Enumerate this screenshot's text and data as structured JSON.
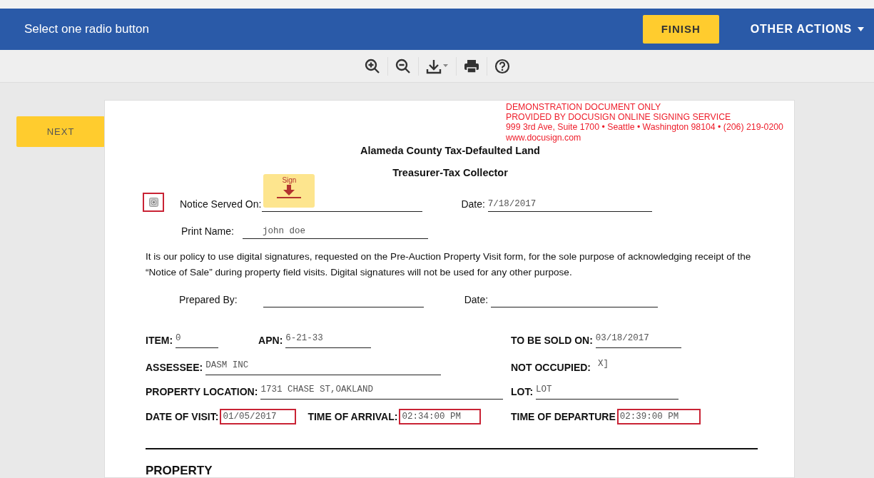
{
  "header": {
    "instruction": "Select one radio button",
    "finish_button": "FINISH",
    "other_actions": "OTHER ACTIONS"
  },
  "toolbar": [
    {
      "kind": "zoom_in"
    },
    {
      "kind": "zoom_out"
    },
    {
      "kind": "download"
    },
    {
      "kind": "print"
    },
    {
      "kind": "help"
    }
  ],
  "next_button": "NEXT",
  "document": {
    "notice": [
      "DEMONSTRATION DOCUMENT ONLY",
      "PROVIDED BY DOCUSIGN ONLINE SIGNING SERVICE",
      "999 3rd Ave, Suite 1700  • Seattle • Washington 98104 • (206) 219-0200",
      "www.docusign.com"
    ],
    "title": "Alameda County Tax-Defaulted Land",
    "subtitle": "Treasurer-Tax Collector",
    "radio": {
      "required": true,
      "selected": false
    },
    "notice_served": {
      "label": "Notice Served On:",
      "sign_tab": "Sign"
    },
    "served_date": {
      "label": "Date:",
      "value": "7/18/2017"
    },
    "print_name": {
      "label": "Print Name:",
      "value": "john doe"
    },
    "policy": "It is our policy to use digital signatures, requested on the Pre-Auction Property Visit form, for the sole purpose of acknowledging receipt of the “Notice of Sale” during property field visits. Digital signatures will not be used for any other purpose.",
    "prepared_by": {
      "label": "Prepared By:"
    },
    "prepared_date": {
      "label": "Date:"
    },
    "records": [
      {
        "left": [
          {
            "label": "ITEM:",
            "value": "0",
            "required": false
          },
          {
            "label": "APN:",
            "value": "6-21-33",
            "required": false
          }
        ],
        "right": {
          "label": "TO BE SOLD ON:",
          "value": "03/18/2017",
          "required": false
        }
      },
      {
        "left": [
          {
            "label": "ASSESSEE:",
            "value": "DASM INC",
            "required": false
          }
        ],
        "right": {
          "label": "NOT OCCUPIED:",
          "value": "X]",
          "required": false
        }
      },
      {
        "left": [
          {
            "label": "PROPERTY LOCATION:",
            "value": "1731 CHASE ST,OAKLAND",
            "required": false
          }
        ],
        "right": {
          "label": "LOT:",
          "value": "LOT",
          "required": false
        }
      },
      {
        "left": [
          {
            "label": "DATE OF VISIT:",
            "value": "01/05/2017",
            "required": true
          },
          {
            "label": "TIME OF ARRIVAL:",
            "value": "02:34:00 PM",
            "required": true
          }
        ],
        "right": {
          "label": "TIME OF DEPARTURE",
          "value": "02:39:00 PM",
          "required": true
        }
      }
    ],
    "section_heading": "PROPERTY"
  }
}
